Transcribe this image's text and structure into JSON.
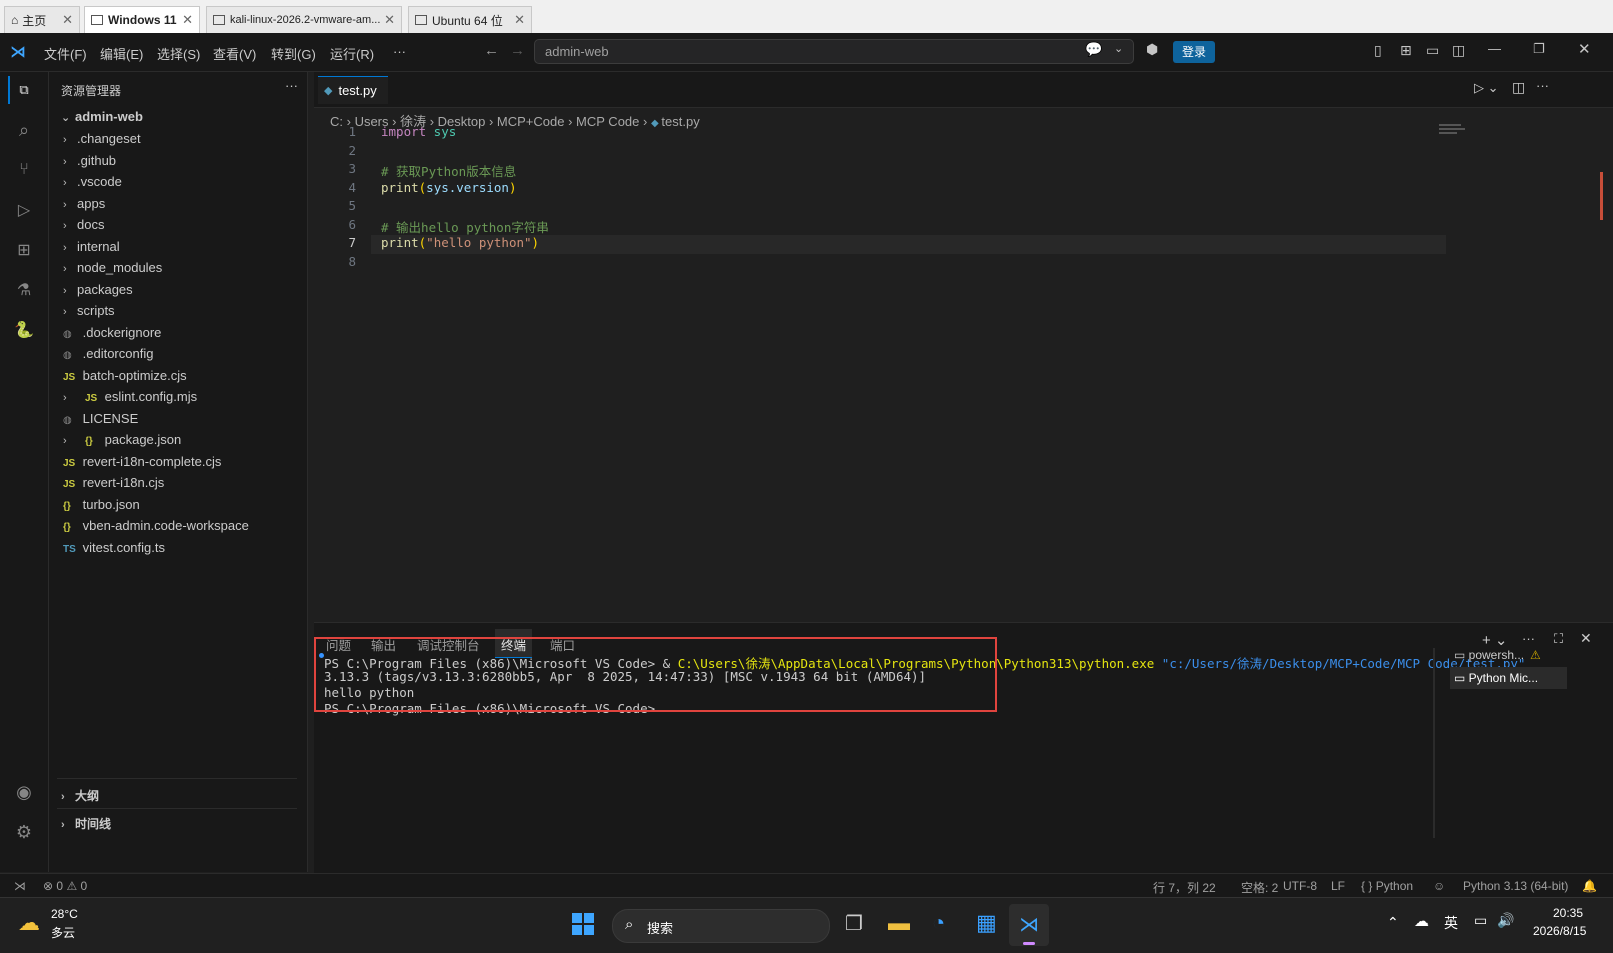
{
  "vm_tabs": [
    {
      "label": "主页"
    },
    {
      "label": "Windows 11"
    },
    {
      "label": "kali-linux-2026.2-vmware-am..."
    },
    {
      "label": "Ubuntu 64 位"
    }
  ],
  "menu": [
    "文件(F)",
    "编辑(E)",
    "选择(S)",
    "查看(V)",
    "转到(G)",
    "运行(R)",
    "···"
  ],
  "command_center": {
    "text": "admin-web"
  },
  "login_label": "登录",
  "sidebar": {
    "title": "资源管理器",
    "more": "···",
    "root": "admin-web",
    "items": [
      {
        "label": ".changeset",
        "kind": "folder"
      },
      {
        "label": ".github",
        "kind": "folder"
      },
      {
        "label": ".vscode",
        "kind": "folder"
      },
      {
        "label": "apps",
        "kind": "folder"
      },
      {
        "label": "docs",
        "kind": "folder"
      },
      {
        "label": "internal",
        "kind": "folder"
      },
      {
        "label": "node_modules",
        "kind": "folder"
      },
      {
        "label": "packages",
        "kind": "folder"
      },
      {
        "label": "scripts",
        "kind": "folder"
      },
      {
        "label": ".dockerignore",
        "kind": "file"
      },
      {
        "label": ".editorconfig",
        "kind": "file"
      },
      {
        "label": "batch-optimize.cjs",
        "kind": "file",
        "icon_text": "JS"
      },
      {
        "label": "eslint.config.mjs",
        "kind": "folder-file",
        "icon_text": "JS"
      },
      {
        "label": "LICENSE",
        "kind": "file"
      },
      {
        "label": "package.json",
        "kind": "folder-file",
        "icon_text": "{}"
      },
      {
        "label": "revert-i18n-complete.cjs",
        "kind": "file",
        "icon_text": "JS"
      },
      {
        "label": "revert-i18n.cjs",
        "kind": "file",
        "icon_text": "JS"
      },
      {
        "label": "turbo.json",
        "kind": "file",
        "icon_text": "{}"
      },
      {
        "label": "vben-admin.code-workspace",
        "kind": "file",
        "icon_text": "{}"
      },
      {
        "label": "vitest.config.ts",
        "kind": "file",
        "icon_text": "TS"
      }
    ],
    "outline": "大纲",
    "timeline": "时间线"
  },
  "editor": {
    "tab": "test.py",
    "breadcrumb": [
      "C:",
      "Users",
      "徐涛",
      "Desktop",
      "MCP+Code",
      "MCP Code",
      "test.py"
    ],
    "line_numbers": [
      "1",
      "2",
      "3",
      "4",
      "5",
      "6",
      "7",
      "8"
    ],
    "lines": [
      {
        "kw": "import",
        "rest": " sys"
      },
      {},
      {
        "comment": "# 获取Python版本信息"
      },
      {
        "fn": "print",
        "open": "(",
        "arg": "sys.version",
        "close": ")"
      },
      {},
      {
        "comment": "# 输出hello python字符串"
      },
      {
        "fn": "print",
        "open": "(",
        "str": "\"hello python\"",
        "close": ")"
      },
      {}
    ]
  },
  "panel": {
    "tabs": [
      "问题",
      "输出",
      "调试控制台",
      "终端",
      "端口"
    ],
    "active_tab": "终端",
    "terminal_lines": [
      {
        "prompt": "PS C:\\Program Files (x86)\\Microsoft VS Code> & ",
        "exe": "C:\\Users\\徐涛\\AppData\\Local\\Programs\\Python\\Python313\\python.exe",
        "arg": " \"c:/Users/徐涛/Desktop/MCP+Code/MCP Code/test.py\""
      },
      {
        "text": "3.13.3 (tags/v3.13.3:6280bb5, Apr  8 2025, 14:47:33) [MSC v.1943 64 bit (AMD64)]"
      },
      {
        "text": "hello python"
      },
      {
        "text": "PS C:\\Program Files (x86)\\Microsoft VS Code>"
      }
    ],
    "terminals": [
      "powersh...",
      "Python Mic..."
    ],
    "highlight_color": "#e0443e"
  },
  "status": {
    "errors": "0",
    "warnings": "0",
    "position": "行 7，列 22",
    "spaces": "空格: 2",
    "encoding": "UTF-8",
    "eol": "LF",
    "language": "Python",
    "interpreter": "Python 3.13 (64-bit)"
  },
  "taskbar": {
    "temp": "28°C",
    "weather": "多云",
    "search": "搜索",
    "ime": "英",
    "time": "20:35",
    "date": "2026/8/15"
  },
  "colors": {
    "accent": "#0078d4",
    "login": "#0e639c"
  }
}
